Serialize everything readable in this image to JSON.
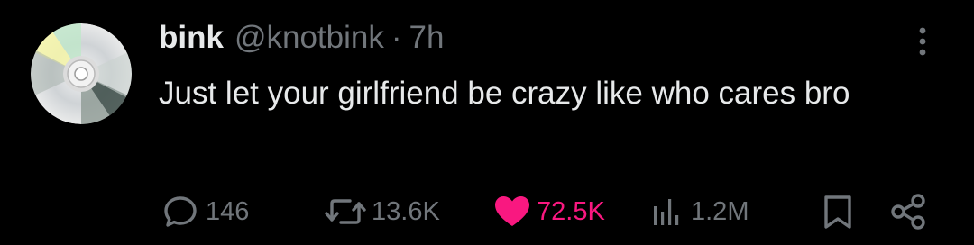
{
  "tweet": {
    "display_name": "bink",
    "handle": "@knotbink",
    "separator": "·",
    "time": "7h",
    "text": "Just let your girlfriend be crazy like who cares bro"
  },
  "actions": {
    "replies": "146",
    "reposts": "13.6K",
    "likes": "72.5K",
    "views": "1.2M"
  },
  "colors": {
    "background": "#000000",
    "primary_text": "#e7e9ea",
    "secondary_text": "#71767b",
    "like_pink": "#f91880"
  },
  "icons": {
    "avatar": "cd-disc-avatar",
    "more": "more-vertical-icon",
    "reply": "reply-bubble-icon",
    "repost": "repost-arrows-icon",
    "like": "heart-filled-icon",
    "views": "views-bar-chart-icon",
    "bookmark": "bookmark-icon",
    "share": "share-icon"
  }
}
